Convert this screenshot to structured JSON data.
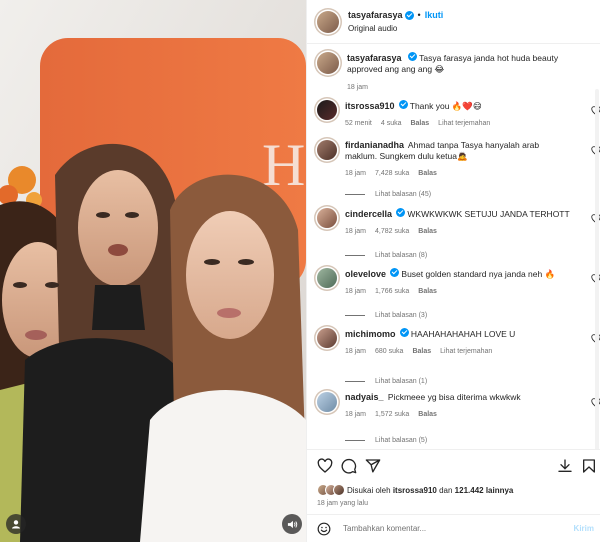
{
  "header": {
    "username": "tasyafarasya",
    "follow_label": "Ikuti",
    "audio": "Original audio"
  },
  "caption": {
    "username": "tasyafarasya",
    "text": "Tasya farasya janda hot huda beauty approved ang ang ang 😂",
    "time": "18 jam"
  },
  "comments": [
    {
      "username": "itsrossa910",
      "verified": true,
      "text": "Thank you 🔥❤️😄",
      "time": "52 menit",
      "likes": "4 suka",
      "reply": "Balas",
      "extra": "Lihat terjemahan",
      "more": ""
    },
    {
      "username": "firdanianadha",
      "verified": false,
      "text": "Ahmad tanpa Tasya hanyalah arab maklum. Sungkem dulu ketua🙇",
      "time": "18 jam",
      "likes": "7,428 suka",
      "reply": "Balas",
      "extra": "",
      "more": "Lihat balasan (45)"
    },
    {
      "username": "cindercella",
      "verified": true,
      "text": "WKWKWKWK SETUJU JANDA TERHOTT",
      "time": "18 jam",
      "likes": "4,782 suka",
      "reply": "Balas",
      "extra": "",
      "more": "Lihat balasan (8)"
    },
    {
      "username": "olevelove",
      "verified": true,
      "text": "Buset golden standard nya janda neh 🔥",
      "time": "18 jam",
      "likes": "1,766 suka",
      "reply": "Balas",
      "extra": "",
      "more": "Lihat balasan (3)"
    },
    {
      "username": "michimomo",
      "verified": true,
      "text": "HAAHAHAHAHAH LOVE U",
      "time": "18 jam",
      "likes": "680 suka",
      "reply": "Balas",
      "extra": "Lihat terjemahan",
      "more": "Lihat balasan (1)"
    },
    {
      "username": "nadyais_",
      "verified": false,
      "text": "Pickmeee yg bisa diterima wkwkwk",
      "time": "18 jam",
      "likes": "1,572 suka",
      "reply": "Balas",
      "extra": "",
      "more": "Lihat balasan (5)"
    }
  ],
  "likes": {
    "prefix": "Disukai oleh",
    "user": "itsrossa910",
    "and": "dan",
    "count": "121.442 lainnya"
  },
  "age": "18 jam yang lalu",
  "add_comment": {
    "placeholder": "Tambahkan komentar...",
    "post_label": "Kirim"
  },
  "colors": {
    "accent": "#0095f6",
    "muted": "#737373",
    "like_red": "#ed4956"
  },
  "icons": [
    "heart-icon",
    "comment-icon",
    "share-icon",
    "download-icon",
    "bookmark-icon",
    "smiley-icon",
    "user-icon",
    "volume-icon"
  ]
}
